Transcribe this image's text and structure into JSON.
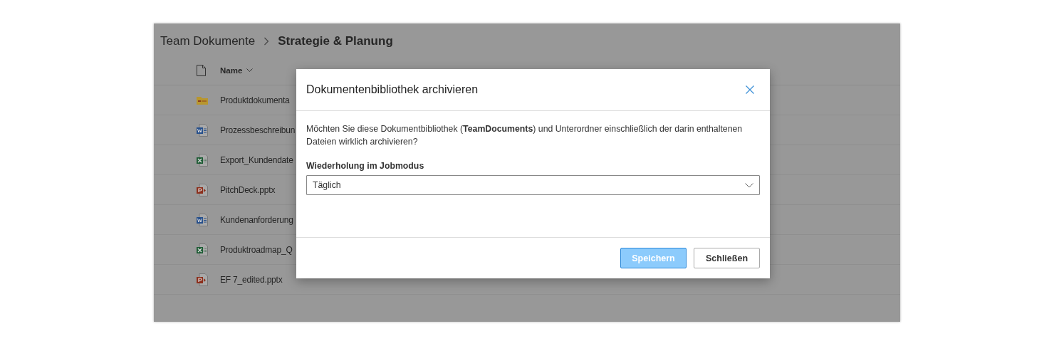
{
  "breadcrumb": [
    {
      "label": "Team Dokumente",
      "current": false
    },
    {
      "label": "Strategie & Planung",
      "current": true
    }
  ],
  "table": {
    "columns": [
      {
        "label": "Name"
      }
    ],
    "rows": [
      {
        "kind": "folder",
        "name": "Produktdokumenta"
      },
      {
        "kind": "word",
        "name": "Prozessbeschreibun"
      },
      {
        "kind": "excel",
        "name": "Export_Kundendate"
      },
      {
        "kind": "powerpoint",
        "name": "PitchDeck.pptx"
      },
      {
        "kind": "word",
        "name": "Kundenanforderung"
      },
      {
        "kind": "excel",
        "name": "Produktroadmap_Q"
      },
      {
        "kind": "powerpoint",
        "name": "EF 7_edited.pptx"
      }
    ]
  },
  "dialog": {
    "title": "Dokumentenbibliothek archivieren",
    "message": "Möchten Sie diese Dokumentbibliothek (**TeamDocuments**) und Unterordner einschließlich der darin enthaltenen Dateien wirklich archivieren?",
    "field": {
      "label": "Wiederholung im Jobmodus",
      "value": "Täglich"
    },
    "buttons": [
      {
        "label": "Speichern",
        "kind": "primary",
        "disabled": true
      },
      {
        "label": "Schließen",
        "kind": "default",
        "disabled": false
      }
    ]
  }
}
